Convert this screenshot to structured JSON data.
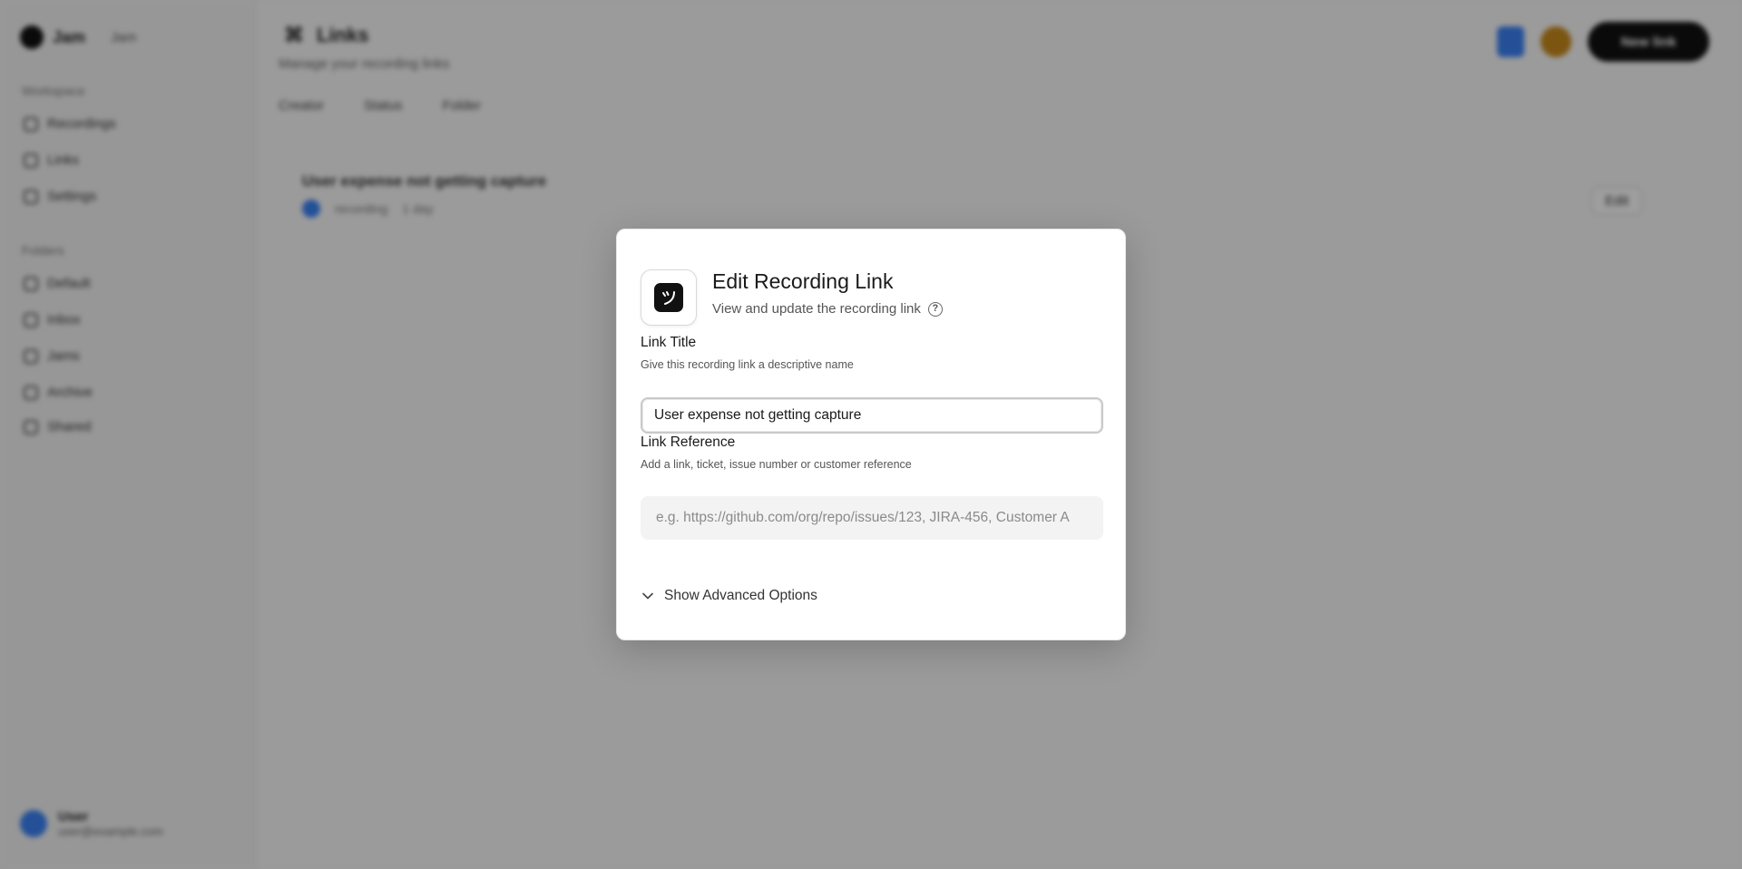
{
  "background": {
    "brand": "Jam",
    "workspace": "Jam",
    "section_label_1": "Workspace",
    "nav_1": [
      "Recordings",
      "Links",
      "Settings"
    ],
    "section_label_2": "Folders",
    "nav_2": [
      "Default",
      "Inbox",
      "Jams",
      "Archive",
      "Shared"
    ],
    "user_name": "User",
    "user_email": "user@example.com",
    "page_title": "Links",
    "page_subtitle": "Manage your recording links",
    "filters": [
      "Creator",
      "Status",
      "Folder"
    ],
    "record_title": "User expense not getting capture",
    "record_meta_1": "recording",
    "record_meta_2": "1 day",
    "record_button": "Edit",
    "cta_label": "New link"
  },
  "modal": {
    "title": "Edit Recording Link",
    "subtitle": "View and update the recording link",
    "help_glyph": "?",
    "link_title_label": "Link Title",
    "link_title_help": "Give this recording link a descriptive name",
    "link_title_value": "User expense not getting capture",
    "link_ref_label": "Link Reference",
    "link_ref_help": "Add a link, ticket, issue number or customer reference",
    "link_ref_placeholder": "e.g. https://github.com/org/repo/issues/123, JIRA-456, Customer A",
    "advanced_label": "Show Advanced Options"
  }
}
